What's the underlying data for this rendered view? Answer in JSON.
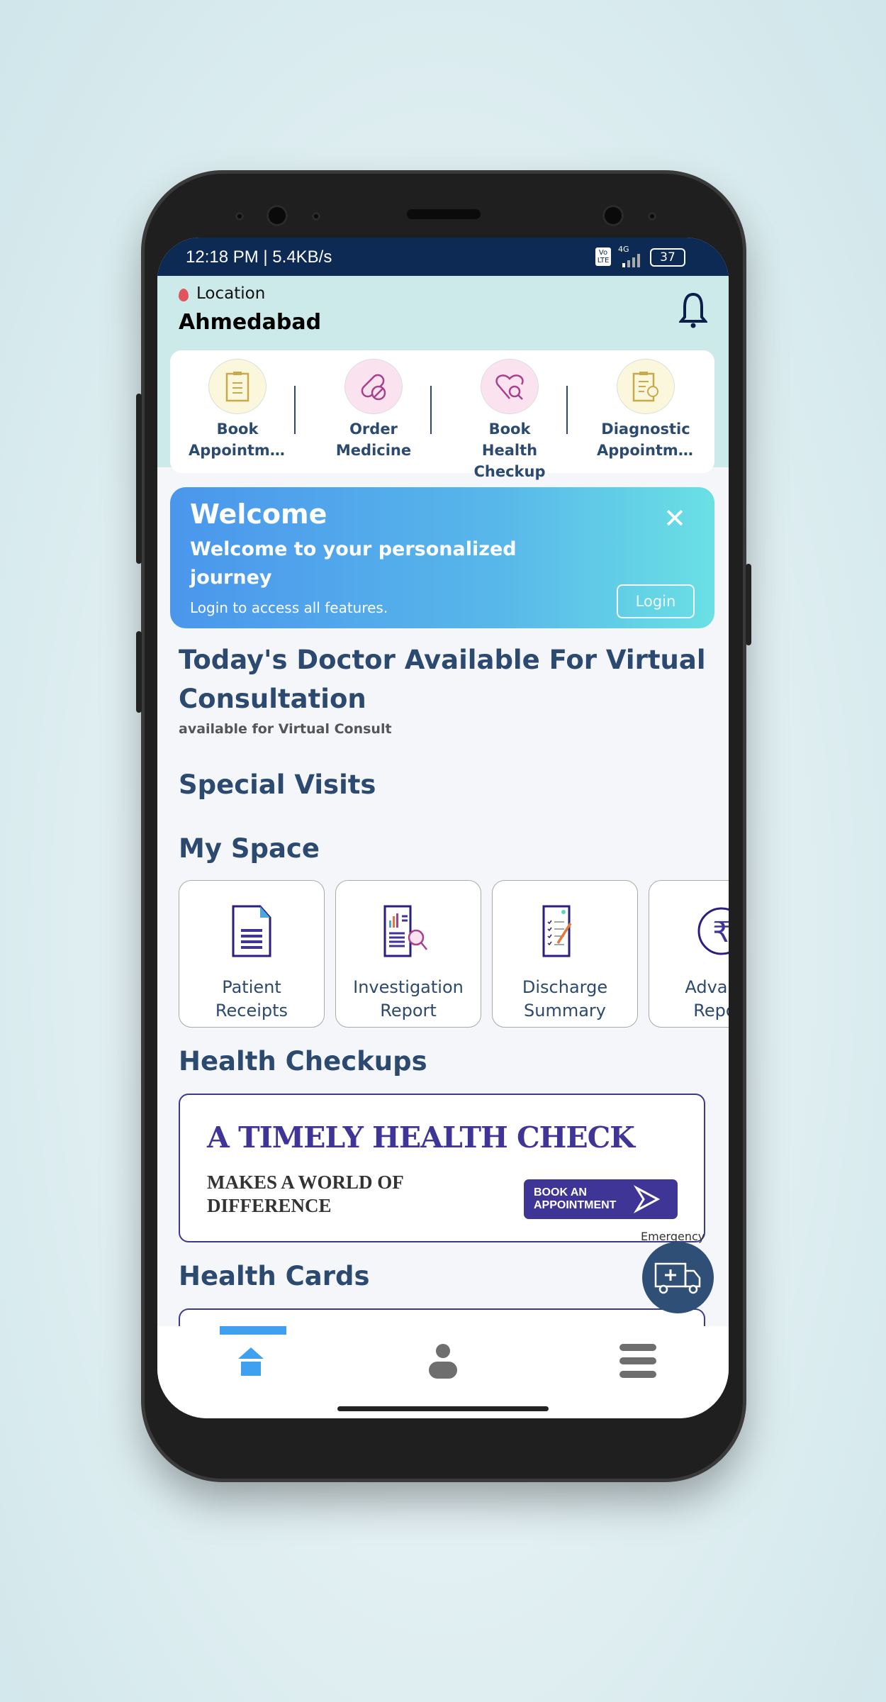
{
  "status_bar": {
    "time_speed": "12:18 PM | 5.4KB/s",
    "network": "4G",
    "volte": "Vo LTE",
    "battery": "37"
  },
  "header": {
    "location_label": "Location",
    "city": "Ahmedabad"
  },
  "quick_actions": [
    {
      "label": "Book Appointme...",
      "icon": "clipboard-icon"
    },
    {
      "label": "Order Medicine",
      "icon": "pills-icon"
    },
    {
      "label": "Book Health Checkup",
      "icon": "heart-search-icon"
    },
    {
      "label": "Diagnostic Appointme...",
      "icon": "clipboard-clock-icon"
    }
  ],
  "welcome": {
    "title": "Welcome",
    "subtitle": "Welcome to your personalized journey",
    "note": "Login to access all features.",
    "login": "Login"
  },
  "sections": {
    "virtual": {
      "title": "Today's Doctor Available For Virtual Consultation",
      "subtitle": "available for Virtual Consult"
    },
    "special_visits": "Special Visits",
    "my_space": "My Space",
    "health_checkups": "Health Checkups",
    "health_cards": "Health Cards"
  },
  "my_space": [
    {
      "line1": "Patient",
      "line2": "Receipts"
    },
    {
      "line1": "Investigation",
      "line2": "Report"
    },
    {
      "line1": "Discharge",
      "line2": "Summary"
    },
    {
      "line1": "Advance",
      "line2": "Report"
    }
  ],
  "banner": {
    "headline": "A TIMELY HEALTH CHECK",
    "line1": "MAKES A WORLD OF",
    "line2": "DIFFERENCE",
    "cta1": "BOOK AN",
    "cta2": "APPOINTMENT"
  },
  "emergency": "Emergency",
  "colors": {
    "primary": "#2c4a70",
    "status_bar": "#0c2a54",
    "accent": "#3fa0f0",
    "banner": "#3f3597"
  }
}
